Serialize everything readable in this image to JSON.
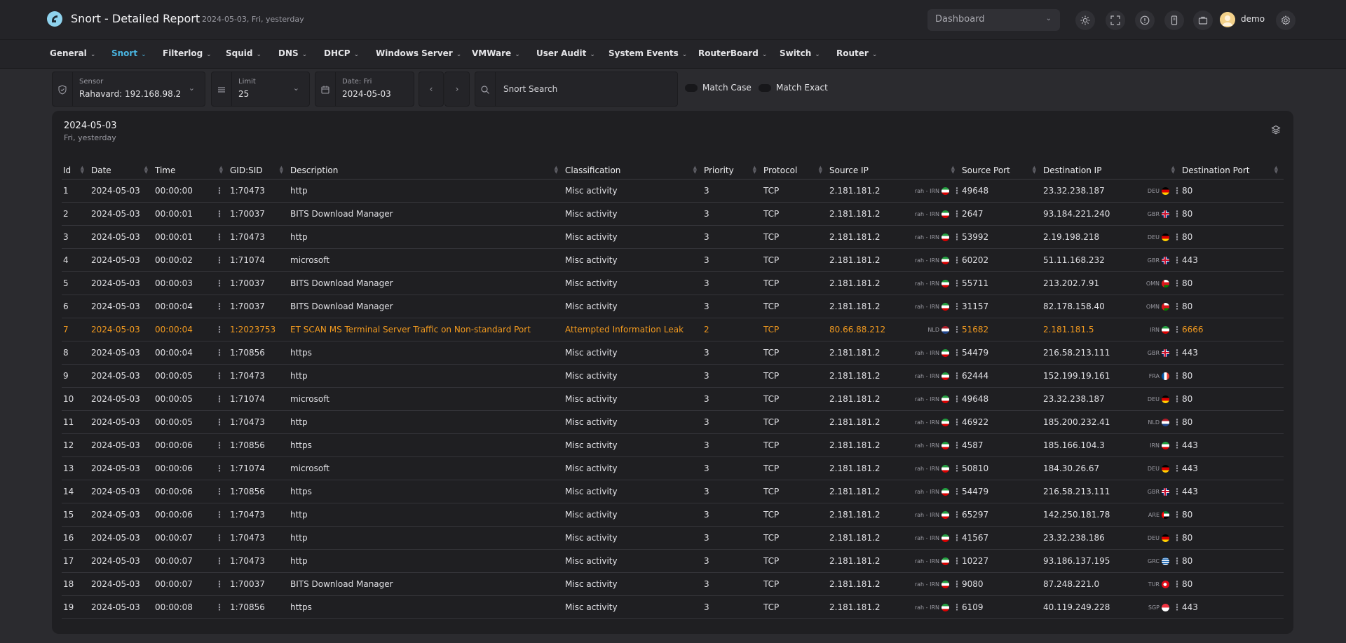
{
  "header": {
    "title": "Snort - Detailed Report",
    "subtitle": "2024-05-03, Fri, yesterday",
    "dashboard_select": "Dashboard",
    "user_name": "demo"
  },
  "nav": [
    {
      "label": "General"
    },
    {
      "label": "Snort"
    },
    {
      "label": "Filterlog"
    },
    {
      "label": "Squid"
    },
    {
      "label": "DNS"
    },
    {
      "label": "DHCP"
    },
    {
      "label": "Windows Server"
    },
    {
      "label": "VMWare"
    },
    {
      "label": "User Audit"
    },
    {
      "label": "System Events"
    },
    {
      "label": "RouterBoard"
    },
    {
      "label": "Switch"
    },
    {
      "label": "Router"
    }
  ],
  "filters": {
    "sensor_label": "Sensor",
    "sensor_value": "Rahavard: 192.168.98.2",
    "limit_label": "Limit",
    "limit_value": "25",
    "date_label": "Date: Fri",
    "date_value": "2024-05-03",
    "search_placeholder": "Snort Search",
    "match_case": "Match Case",
    "match_exact": "Match Exact"
  },
  "card": {
    "date": "2024-05-03",
    "subtitle": "Fri, yesterday"
  },
  "columns": [
    "Id",
    "Date",
    "Time",
    "GID:SID",
    "Description",
    "Classification",
    "Priority",
    "Protocol",
    "Source IP",
    "Source Port",
    "Destination IP",
    "Destination Port"
  ],
  "colors": {
    "accent": "#4ab6e2",
    "alert": "#f29a1f"
  },
  "rows": [
    {
      "id": "1",
      "date": "2024-05-03",
      "time": "00:00:00",
      "sid": "1:70473",
      "desc": "http",
      "cls": "Misc activity",
      "pri": "3",
      "proto": "TCP",
      "src": "2.181.181.2",
      "src_geo": "rah - IRN",
      "src_flag": "IRN",
      "sport": "49648",
      "dst": "23.32.238.187",
      "dst_geo": "DEU",
      "dst_flag": "DEU",
      "dport": "80"
    },
    {
      "id": "2",
      "date": "2024-05-03",
      "time": "00:00:01",
      "sid": "1:70037",
      "desc": "BITS Download Manager",
      "cls": "Misc activity",
      "pri": "3",
      "proto": "TCP",
      "src": "2.181.181.2",
      "src_geo": "rah - IRN",
      "src_flag": "IRN",
      "sport": "2647",
      "dst": "93.184.221.240",
      "dst_geo": "GBR",
      "dst_flag": "GBR",
      "dport": "80"
    },
    {
      "id": "3",
      "date": "2024-05-03",
      "time": "00:00:01",
      "sid": "1:70473",
      "desc": "http",
      "cls": "Misc activity",
      "pri": "3",
      "proto": "TCP",
      "src": "2.181.181.2",
      "src_geo": "rah - IRN",
      "src_flag": "IRN",
      "sport": "53992",
      "dst": "2.19.198.218",
      "dst_geo": "DEU",
      "dst_flag": "DEU",
      "dport": "80"
    },
    {
      "id": "4",
      "date": "2024-05-03",
      "time": "00:00:02",
      "sid": "1:71074",
      "desc": "microsoft",
      "cls": "Misc activity",
      "pri": "3",
      "proto": "TCP",
      "src": "2.181.181.2",
      "src_geo": "rah - IRN",
      "src_flag": "IRN",
      "sport": "60202",
      "dst": "51.11.168.232",
      "dst_geo": "GBR",
      "dst_flag": "GBR",
      "dport": "443"
    },
    {
      "id": "5",
      "date": "2024-05-03",
      "time": "00:00:03",
      "sid": "1:70037",
      "desc": "BITS Download Manager",
      "cls": "Misc activity",
      "pri": "3",
      "proto": "TCP",
      "src": "2.181.181.2",
      "src_geo": "rah - IRN",
      "src_flag": "IRN",
      "sport": "55711",
      "dst": "213.202.7.91",
      "dst_geo": "OMN",
      "dst_flag": "OMN",
      "dport": "80"
    },
    {
      "id": "6",
      "date": "2024-05-03",
      "time": "00:00:04",
      "sid": "1:70037",
      "desc": "BITS Download Manager",
      "cls": "Misc activity",
      "pri": "3",
      "proto": "TCP",
      "src": "2.181.181.2",
      "src_geo": "rah - IRN",
      "src_flag": "IRN",
      "sport": "31157",
      "dst": "82.178.158.40",
      "dst_geo": "OMN",
      "dst_flag": "OMN",
      "dport": "80"
    },
    {
      "id": "7",
      "date": "2024-05-03",
      "time": "00:00:04",
      "sid": "1:2023753",
      "desc": "ET SCAN MS Terminal Server Traffic on Non-standard Port",
      "cls": "Attempted Information Leak",
      "pri": "2",
      "proto": "TCP",
      "src": "80.66.88.212",
      "src_geo": "NLD",
      "src_flag": "NLD",
      "sport": "51682",
      "dst": "2.181.181.5",
      "dst_geo": "IRN",
      "dst_flag": "IRN",
      "dport": "6666",
      "alert": true
    },
    {
      "id": "8",
      "date": "2024-05-03",
      "time": "00:00:04",
      "sid": "1:70856",
      "desc": "https",
      "cls": "Misc activity",
      "pri": "3",
      "proto": "TCP",
      "src": "2.181.181.2",
      "src_geo": "rah - IRN",
      "src_flag": "IRN",
      "sport": "54479",
      "dst": "216.58.213.111",
      "dst_geo": "GBR",
      "dst_flag": "GBR",
      "dport": "443"
    },
    {
      "id": "9",
      "date": "2024-05-03",
      "time": "00:00:05",
      "sid": "1:70473",
      "desc": "http",
      "cls": "Misc activity",
      "pri": "3",
      "proto": "TCP",
      "src": "2.181.181.2",
      "src_geo": "rah - IRN",
      "src_flag": "IRN",
      "sport": "62444",
      "dst": "152.199.19.161",
      "dst_geo": "FRA",
      "dst_flag": "FRA",
      "dport": "80"
    },
    {
      "id": "10",
      "date": "2024-05-03",
      "time": "00:00:05",
      "sid": "1:71074",
      "desc": "microsoft",
      "cls": "Misc activity",
      "pri": "3",
      "proto": "TCP",
      "src": "2.181.181.2",
      "src_geo": "rah - IRN",
      "src_flag": "IRN",
      "sport": "49648",
      "dst": "23.32.238.187",
      "dst_geo": "DEU",
      "dst_flag": "DEU",
      "dport": "80"
    },
    {
      "id": "11",
      "date": "2024-05-03",
      "time": "00:00:05",
      "sid": "1:70473",
      "desc": "http",
      "cls": "Misc activity",
      "pri": "3",
      "proto": "TCP",
      "src": "2.181.181.2",
      "src_geo": "rah - IRN",
      "src_flag": "IRN",
      "sport": "46922",
      "dst": "185.200.232.41",
      "dst_geo": "NLD",
      "dst_flag": "NLD",
      "dport": "80"
    },
    {
      "id": "12",
      "date": "2024-05-03",
      "time": "00:00:06",
      "sid": "1:70856",
      "desc": "https",
      "cls": "Misc activity",
      "pri": "3",
      "proto": "TCP",
      "src": "2.181.181.2",
      "src_geo": "rah - IRN",
      "src_flag": "IRN",
      "sport": "4587",
      "dst": "185.166.104.3",
      "dst_geo": "IRN",
      "dst_flag": "IRN",
      "dport": "443"
    },
    {
      "id": "13",
      "date": "2024-05-03",
      "time": "00:00:06",
      "sid": "1:71074",
      "desc": "microsoft",
      "cls": "Misc activity",
      "pri": "3",
      "proto": "TCP",
      "src": "2.181.181.2",
      "src_geo": "rah - IRN",
      "src_flag": "IRN",
      "sport": "50810",
      "dst": "184.30.26.67",
      "dst_geo": "DEU",
      "dst_flag": "DEU",
      "dport": "443"
    },
    {
      "id": "14",
      "date": "2024-05-03",
      "time": "00:00:06",
      "sid": "1:70856",
      "desc": "https",
      "cls": "Misc activity",
      "pri": "3",
      "proto": "TCP",
      "src": "2.181.181.2",
      "src_geo": "rah - IRN",
      "src_flag": "IRN",
      "sport": "54479",
      "dst": "216.58.213.111",
      "dst_geo": "GBR",
      "dst_flag": "GBR",
      "dport": "443"
    },
    {
      "id": "15",
      "date": "2024-05-03",
      "time": "00:00:06",
      "sid": "1:70473",
      "desc": "http",
      "cls": "Misc activity",
      "pri": "3",
      "proto": "TCP",
      "src": "2.181.181.2",
      "src_geo": "rah - IRN",
      "src_flag": "IRN",
      "sport": "65297",
      "dst": "142.250.181.78",
      "dst_geo": "ARE",
      "dst_flag": "ARE",
      "dport": "80"
    },
    {
      "id": "16",
      "date": "2024-05-03",
      "time": "00:00:07",
      "sid": "1:70473",
      "desc": "http",
      "cls": "Misc activity",
      "pri": "3",
      "proto": "TCP",
      "src": "2.181.181.2",
      "src_geo": "rah - IRN",
      "src_flag": "IRN",
      "sport": "41567",
      "dst": "23.32.238.186",
      "dst_geo": "DEU",
      "dst_flag": "DEU",
      "dport": "80"
    },
    {
      "id": "17",
      "date": "2024-05-03",
      "time": "00:00:07",
      "sid": "1:70473",
      "desc": "http",
      "cls": "Misc activity",
      "pri": "3",
      "proto": "TCP",
      "src": "2.181.181.2",
      "src_geo": "rah - IRN",
      "src_flag": "IRN",
      "sport": "10227",
      "dst": "93.186.137.195",
      "dst_geo": "GRC",
      "dst_flag": "GRC",
      "dport": "80"
    },
    {
      "id": "18",
      "date": "2024-05-03",
      "time": "00:00:07",
      "sid": "1:70037",
      "desc": "BITS Download Manager",
      "cls": "Misc activity",
      "pri": "3",
      "proto": "TCP",
      "src": "2.181.181.2",
      "src_geo": "rah - IRN",
      "src_flag": "IRN",
      "sport": "9080",
      "dst": "87.248.221.0",
      "dst_geo": "TUR",
      "dst_flag": "TUR",
      "dport": "80"
    },
    {
      "id": "19",
      "date": "2024-05-03",
      "time": "00:00:08",
      "sid": "1:70856",
      "desc": "https",
      "cls": "Misc activity",
      "pri": "3",
      "proto": "TCP",
      "src": "2.181.181.2",
      "src_geo": "rah - IRN",
      "src_flag": "IRN",
      "sport": "6109",
      "dst": "40.119.249.228",
      "dst_geo": "SGP",
      "dst_flag": "SGP",
      "dport": "443"
    }
  ]
}
